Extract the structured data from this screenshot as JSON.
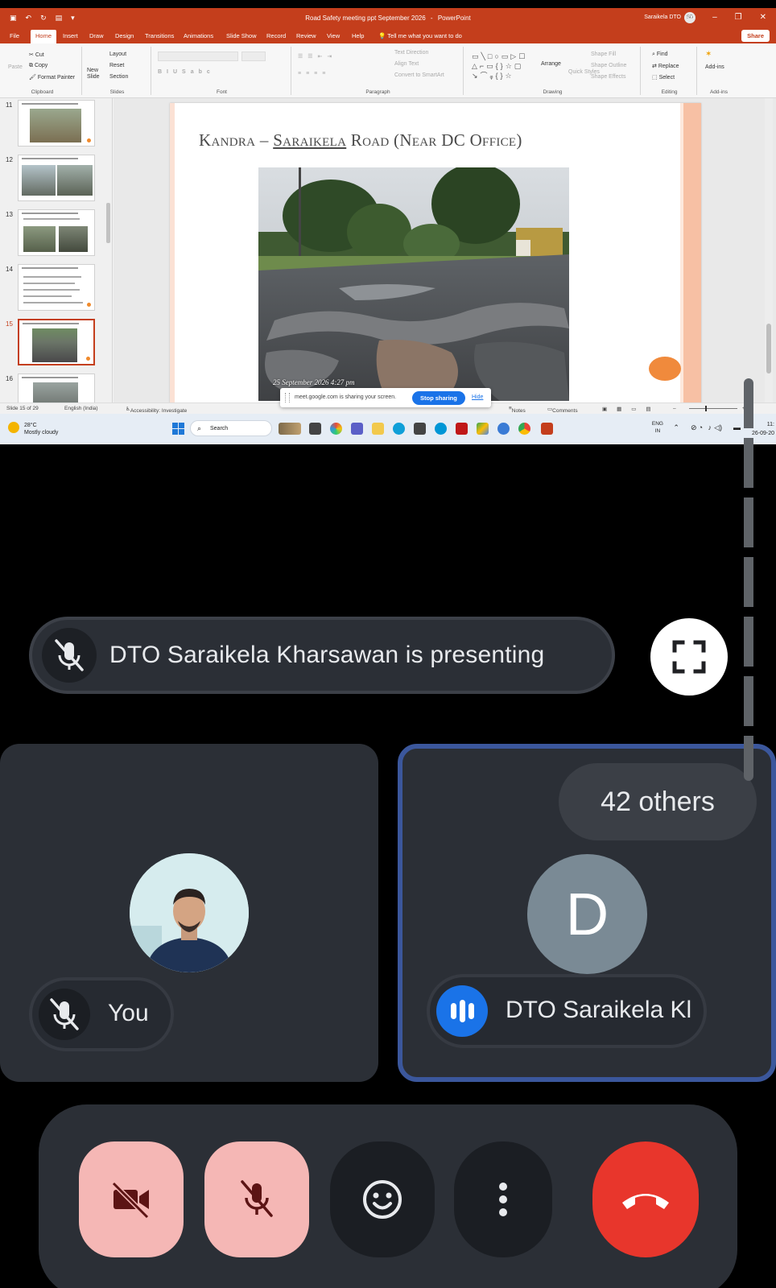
{
  "powerpoint": {
    "document_title": "Road Safety meeting ppt September 2026",
    "app_name": "PowerPoint",
    "user_name": "Saraikela DTO",
    "user_initials": "SD",
    "menu_tabs": [
      "File",
      "Home",
      "Insert",
      "Draw",
      "Design",
      "Transitions",
      "Animations",
      "Slide Show",
      "Record",
      "Review",
      "View",
      "Help"
    ],
    "tell_me": "Tell me what you want to do",
    "share_label": "Share",
    "ribbon": {
      "clipboard": {
        "name": "Clipboard",
        "paste": "Paste",
        "cut": "Cut",
        "copy": "Copy",
        "format_painter": "Format Painter"
      },
      "slides": {
        "name": "Slides",
        "new_slide": "New Slide",
        "layout": "Layout",
        "reset": "Reset",
        "section": "Section"
      },
      "font": {
        "name": "Font"
      },
      "paragraph": {
        "name": "Paragraph",
        "text_direction": "Text Direction",
        "align_text": "Align Text",
        "convert_smartart": "Convert to SmartArt"
      },
      "drawing": {
        "name": "Drawing",
        "arrange": "Arrange",
        "quick_styles": "Quick Styles",
        "shape_fill": "Shape Fill",
        "shape_outline": "Shape Outline",
        "shape_effects": "Shape Effects"
      },
      "editing": {
        "name": "Editing",
        "find": "Find",
        "replace": "Replace",
        "select": "Select"
      },
      "addins": {
        "name": "Add-ins",
        "label": "Add-ins"
      }
    },
    "thumbnails": [
      {
        "num": "11"
      },
      {
        "num": "12"
      },
      {
        "num": "13"
      },
      {
        "num": "14"
      },
      {
        "num": "15"
      },
      {
        "num": "16"
      }
    ],
    "slide": {
      "title_part1": "Kandra – ",
      "title_underlined": "Saraikela",
      "title_part2": " Road (Near DC Office)",
      "photo_timestamp": "25 September 2026 4:27 pm"
    },
    "status": {
      "slide_of": "Slide 15 of 29",
      "language": "English (India)",
      "accessibility": "Accessibility: Investigate",
      "notes": "Notes",
      "comments": "Comments"
    },
    "share_notice": {
      "message": "meet.google.com is sharing your screen.",
      "stop": "Stop sharing",
      "hide": "Hide"
    },
    "taskbar": {
      "temp": "28°C",
      "weather": "Mostly cloudy",
      "search": "Search",
      "lang1": "ENG",
      "lang2": "IN",
      "time": "11:",
      "date": "26-09-20"
    }
  },
  "meet": {
    "presenting_text": "DTO Saraikela Kharsawan is presenting",
    "you_label": "You",
    "others_count": "42 others",
    "other_initial": "D",
    "other_name": "DTO Saraikela Kl",
    "colors": {
      "accent": "#1a73e8",
      "leave": "#e8362c",
      "muted_bg": "#f5b7b5",
      "tile_border": "#3b579c"
    },
    "icons": [
      "mic-off-icon",
      "fullscreen-icon",
      "speaking-icon",
      "camera-off-icon",
      "emoji-icon",
      "more-vert-icon",
      "call-end-icon"
    ]
  }
}
